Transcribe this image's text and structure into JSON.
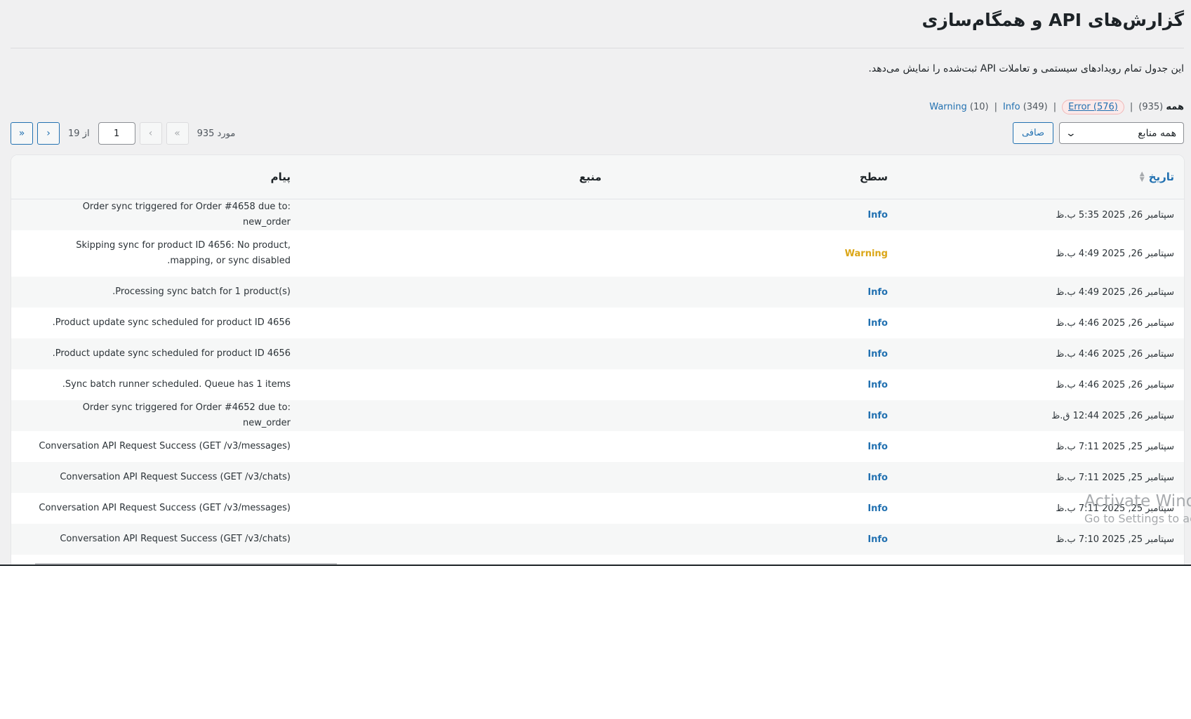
{
  "header": {
    "title": "گزارش‌های API و همگام‌سازی",
    "description": "این جدول تمام رویدادهای سیستمی و تعاملات API ثبت‌شده را نمایش می‌دهد."
  },
  "views": {
    "all_label": "همه",
    "all_count": "(935)",
    "error_label": "Error (576)",
    "info_label": "Info",
    "info_count": "(349)",
    "warning_label": "Warning",
    "warning_count": "(10)",
    "separator": "|"
  },
  "filters": {
    "source_selected": "همه منابع",
    "filter_button": "صافی"
  },
  "pagination": {
    "items_text": "935 مورد",
    "first": "«",
    "prev": "‹",
    "current_page": "1",
    "of_text": "از 19",
    "next": "›",
    "last": "»"
  },
  "table": {
    "columns": {
      "date": "تاریخ",
      "level": "سطح",
      "source": "منبع",
      "message": "پیام"
    },
    "rows": [
      {
        "date": "سپتامبر 26, 2025 5:35 ب.ظ",
        "level": "Info",
        "source": "",
        "message": "Order sync triggered for Order #4658 due to: new_order"
      },
      {
        "date": "سپتامبر 26, 2025 4:49 ب.ظ",
        "level": "Warning",
        "source": "",
        "message": "Skipping sync for product ID 4656: No product, mapping, or sync disabled."
      },
      {
        "date": "سپتامبر 26, 2025 4:49 ب.ظ",
        "level": "Info",
        "source": "",
        "message": "Processing sync batch for 1 product(s)."
      },
      {
        "date": "سپتامبر 26, 2025 4:46 ب.ظ",
        "level": "Info",
        "source": "",
        "message": "Product update sync scheduled for product ID 4656."
      },
      {
        "date": "سپتامبر 26, 2025 4:46 ب.ظ",
        "level": "Info",
        "source": "",
        "message": "Product update sync scheduled for product ID 4656."
      },
      {
        "date": "سپتامبر 26, 2025 4:46 ب.ظ",
        "level": "Info",
        "source": "",
        "message": "Sync batch runner scheduled. Queue has 1 items."
      },
      {
        "date": "سپتامبر 26, 2025 12:44 ق.ظ",
        "level": "Info",
        "source": "",
        "message": "Order sync triggered for Order #4652 due to: new_order"
      },
      {
        "date": "سپتامبر 25, 2025 7:11 ب.ظ",
        "level": "Info",
        "source": "",
        "message": "Conversation API Request Success (GET /v3/messages)"
      },
      {
        "date": "سپتامبر 25, 2025 7:11 ب.ظ",
        "level": "Info",
        "source": "",
        "message": "Conversation API Request Success (GET /v3/chats)"
      },
      {
        "date": "سپتامبر 25, 2025 7:11 ب.ظ",
        "level": "Info",
        "source": "",
        "message": "Conversation API Request Success (GET /v3/messages)"
      },
      {
        "date": "سپتامبر 25, 2025 7:10 ب.ظ",
        "level": "Info",
        "source": "",
        "message": "Conversation API Request Success (GET /v3/chats)"
      }
    ]
  },
  "watermark": {
    "line1": "Activate Windows",
    "line2": "Go to Settings to activate Windows."
  }
}
